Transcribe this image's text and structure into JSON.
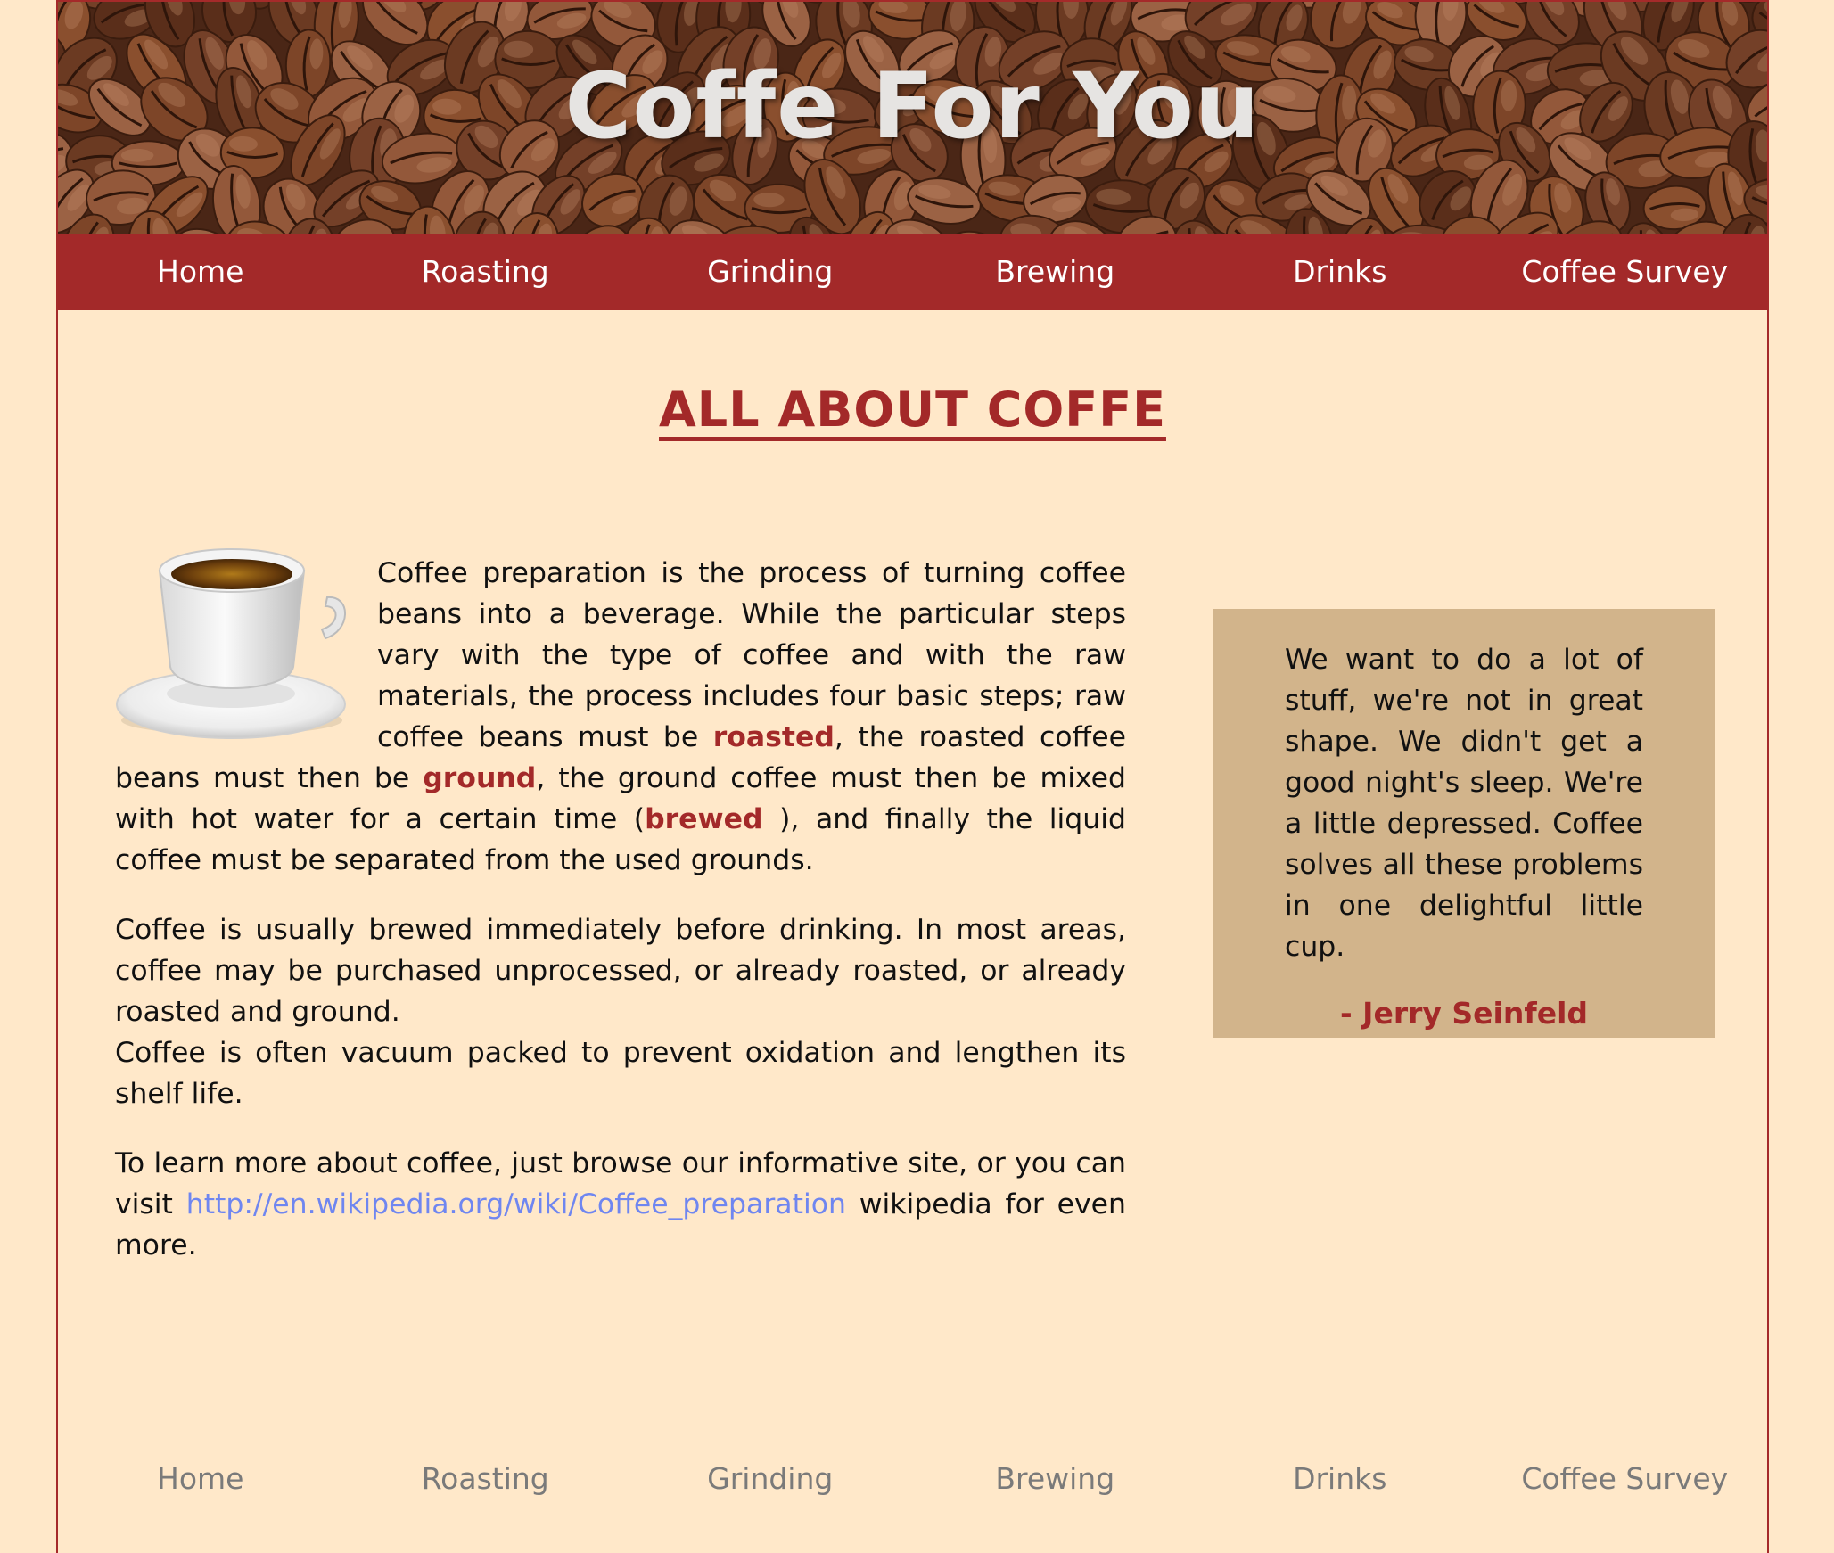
{
  "site": {
    "title": "Coffe For You"
  },
  "nav": {
    "items": [
      "Home",
      "Roasting",
      "Grinding",
      "Brewing",
      "Drinks",
      "Coffee Survey"
    ]
  },
  "main": {
    "heading": "ALL ABOUT COFFE",
    "para1": {
      "t1": "Coffee preparation is the process of turning coffee beans into a beverage. While the particular steps vary with the type of coffee and with the raw materials, the process includes four basic steps; raw coffee beans must be ",
      "roasted": "roasted",
      "t2": ", the roasted coffee beans must then be ",
      "ground": "ground",
      "t3": ", the ground coffee must then be mixed with hot water for a certain time (",
      "brewed": "brewed",
      "t4": " ), and finally the liquid coffee must be separated from the used grounds."
    },
    "para2a": "Coffee is usually brewed immediately before drinking. In most areas, coffee may be purchased unprocessed, or already roasted, or already roasted and ground.",
    "para2b": "Coffee is often vacuum packed to prevent oxidation and lengthen its shelf life.",
    "para3": {
      "t1": "To learn more about coffee, just browse our informative site, or you can visit ",
      "link": "http://en.wikipedia.org/wiki/Coffee_preparation",
      "t2": " wikipedia for even more."
    }
  },
  "quote": {
    "text": "We want to do a lot of stuff, we're not in great shape. We didn't get a good night's sleep. We're a little depressed. Coffee solves all these problems in one delightful little cup.",
    "author": "- Jerry Seinfeld"
  },
  "footer": {
    "items": [
      "Home",
      "Roasting",
      "Grinding",
      "Brewing",
      "Drinks",
      "Coffee Survey"
    ]
  },
  "colors": {
    "accent": "#a32929",
    "background": "#ffe8c9",
    "quote_bg": "#d2b48b",
    "link": "#6f86f0"
  }
}
